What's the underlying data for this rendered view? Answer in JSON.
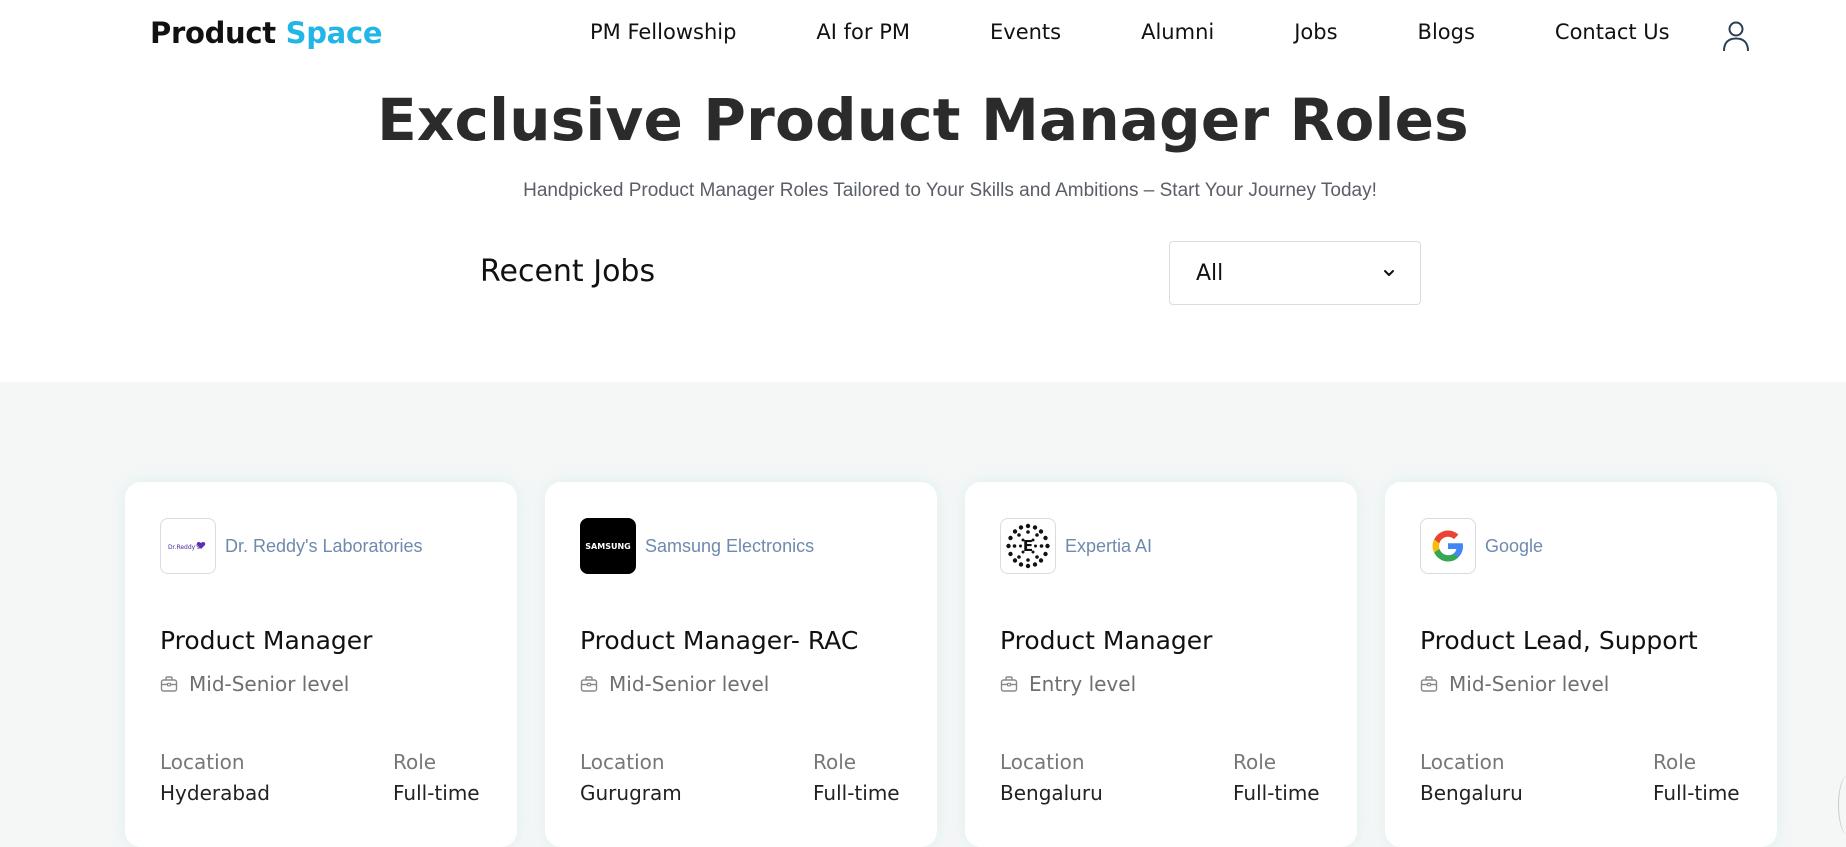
{
  "nav": {
    "logo_part1": "Product",
    "logo_part2": "Space",
    "links": [
      "PM Fellowship",
      "AI for PM",
      "Events",
      "Alumni",
      "Jobs",
      "Blogs",
      "Contact Us"
    ],
    "user_icon": "user-icon"
  },
  "hero": {
    "title": "Exclusive Product Manager Roles",
    "subtitle": "Handpicked Product Manager Roles Tailored to Your Skills and Ambitions – Start Your Journey Today!"
  },
  "recent": {
    "heading": "Recent Jobs",
    "filter_value": "All"
  },
  "jobs": [
    {
      "company": "Dr. Reddy's Laboratories",
      "logo_text": "Dr.Reddy's",
      "title": "Product Manager",
      "level": "Mid-Senior level",
      "location_label": "Location",
      "location": "Hyderabad",
      "role_label": "Role",
      "role": "Full-time"
    },
    {
      "company": "Samsung Electronics",
      "logo_text": "SAMSUNG",
      "title": "Product Manager- RAC",
      "level": "Mid-Senior level",
      "location_label": "Location",
      "location": "Gurugram",
      "role_label": "Role",
      "role": "Full-time"
    },
    {
      "company": "Expertia AI",
      "logo_text": "E",
      "title": "Product Manager",
      "level": "Entry level",
      "location_label": "Location",
      "location": "Bengaluru",
      "role_label": "Role",
      "role": "Full-time"
    },
    {
      "company": "Google",
      "logo_text": "G",
      "title": "Product Lead, Support",
      "level": "Mid-Senior level",
      "location_label": "Location",
      "location": "Bengaluru",
      "role_label": "Role",
      "role": "Full-time"
    }
  ],
  "colors": {
    "brand_accent": "#22b5e8",
    "company_text": "#6e8aae",
    "section_bg": "#f5f7f7"
  }
}
